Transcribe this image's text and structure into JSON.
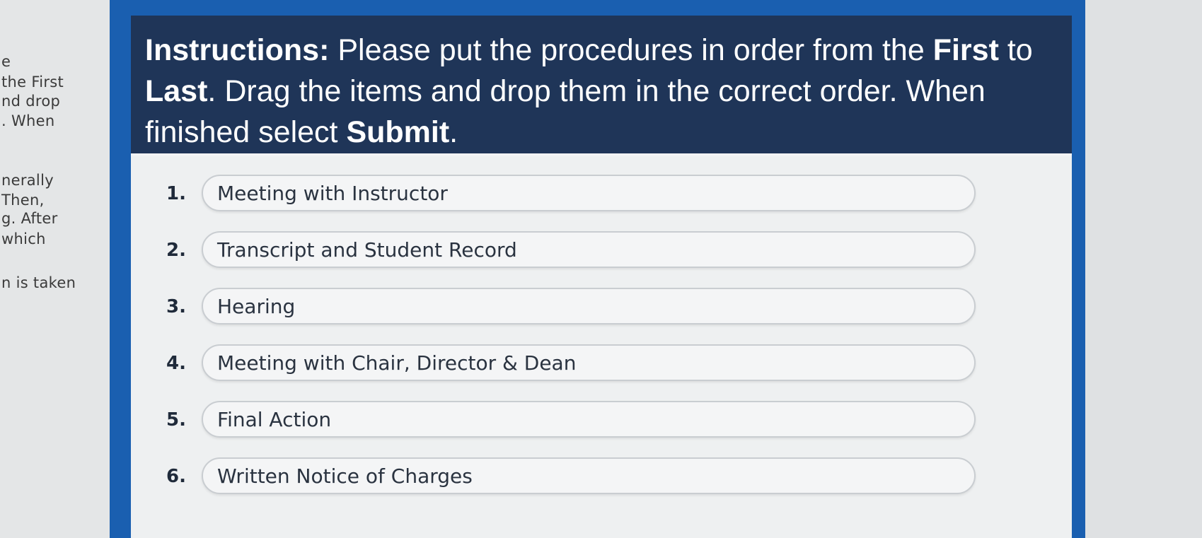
{
  "background_left": {
    "lines": [
      "e",
      "the First",
      "nd drop",
      ". When",
      "nerally",
      "Then,",
      "g. After",
      "which",
      "n is taken"
    ]
  },
  "instructions": {
    "label": "Instructions:",
    "text_1": " Please put the procedures in order from the ",
    "first": "First",
    "text_2": " to ",
    "last": "Last",
    "text_3": ". Drag the items and drop them in the correct order. When finished select ",
    "submit": "Submit",
    "text_4": "."
  },
  "items": [
    {
      "number": "1.",
      "label": "Meeting with Instructor"
    },
    {
      "number": "2.",
      "label": "Transcript and Student Record"
    },
    {
      "number": "3.",
      "label": "Hearing"
    },
    {
      "number": "4.",
      "label": "Meeting with Chair, Director & Dean"
    },
    {
      "number": "5.",
      "label": "Final Action"
    },
    {
      "number": "6.",
      "label": "Written Notice of Charges"
    }
  ]
}
